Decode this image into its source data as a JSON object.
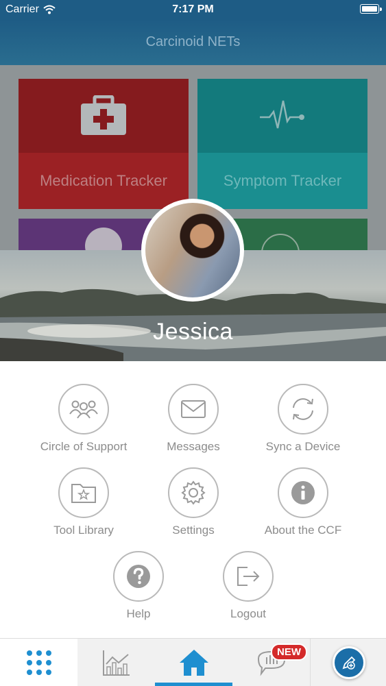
{
  "status_bar": {
    "carrier": "Carrier",
    "time": "7:17 PM"
  },
  "nav": {
    "title": "Carcinoid NETs"
  },
  "dashboard": {
    "tiles": [
      {
        "label": "Medication Tracker",
        "icon": "first-aid-kit-icon"
      },
      {
        "label": "Symptom Tracker",
        "icon": "heartbeat-icon"
      }
    ]
  },
  "profile": {
    "name": "Jessica"
  },
  "menu": {
    "items": [
      {
        "label": "Circle of Support",
        "icon": "people-icon"
      },
      {
        "label": "Messages",
        "icon": "envelope-icon"
      },
      {
        "label": "Sync a Device",
        "icon": "sync-icon"
      },
      {
        "label": "Tool Library",
        "icon": "folder-star-icon"
      },
      {
        "label": "Settings",
        "icon": "gear-icon"
      },
      {
        "label": "About the CCF",
        "icon": "info-icon"
      },
      {
        "label": "Help",
        "icon": "question-icon"
      },
      {
        "label": "Logout",
        "icon": "logout-icon"
      }
    ]
  },
  "tabbar": {
    "news_badge": "NEW",
    "active": "home"
  },
  "colors": {
    "accent": "#1f8fd0",
    "badge": "#d42a2a",
    "icon_gray": "#9a9a9a"
  }
}
